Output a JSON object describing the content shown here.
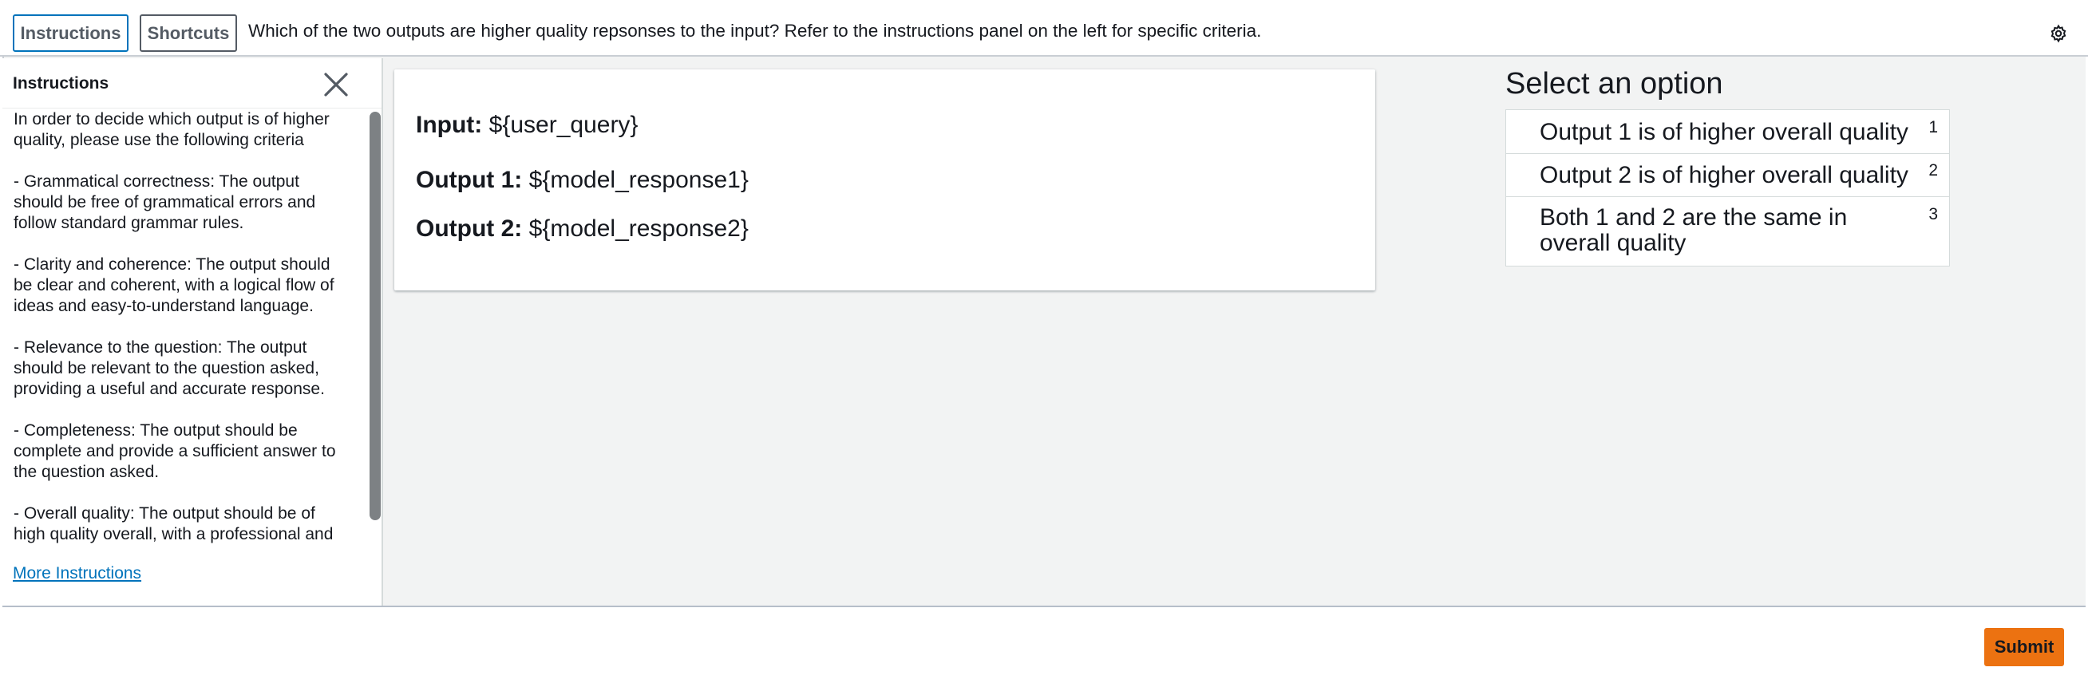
{
  "header": {
    "instructions_button": "Instructions",
    "shortcuts_button": "Shortcuts",
    "question": "Which of the two outputs are higher quality repsonses to the input? Refer to the instructions panel on the left for specific criteria.",
    "settings_icon": "gear-icon"
  },
  "instructions": {
    "title": "Instructions",
    "close_icon": "close-icon",
    "paragraphs": [
      "In order to decide which output is of higher quality, please use the following criteria",
      "- Grammatical correctness: The output should be free of grammatical errors and follow standard grammar rules.",
      "- Clarity and coherence: The output should be clear and coherent, with a logical flow of ideas and easy-to-understand language.",
      "- Relevance to the question: The output should be relevant to the question asked, providing a useful and accurate response.",
      "- Completeness: The output should be complete and provide a sufficient answer to the question asked.",
      "- Overall quality: The output should be of high quality overall, with a professional and"
    ],
    "more_link": "More Instructions"
  },
  "content": {
    "input_label": "Input:",
    "input_value": "${user_query}",
    "output1_label": "Output 1:",
    "output1_value": "${model_response1}",
    "output2_label": "Output 2:",
    "output2_value": "${model_response2}"
  },
  "selection": {
    "title": "Select an option",
    "options": [
      {
        "label": "Output 1 is of higher overall quality",
        "key": "1"
      },
      {
        "label": "Output 2 is of higher overall quality",
        "key": "2"
      },
      {
        "label": "Both 1 and 2 are the same in overall quality",
        "key": "3"
      }
    ]
  },
  "footer": {
    "submit": "Submit"
  },
  "colors": {
    "accent": "#0073bb",
    "submit": "#ec7211",
    "background": "#f2f3f3"
  }
}
